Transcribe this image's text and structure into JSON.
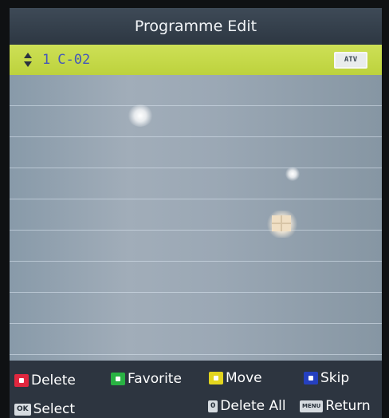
{
  "title": "Programme Edit",
  "selected_channel": {
    "number": "1",
    "name": "C-02",
    "type_badge": "ATV"
  },
  "colors": {
    "header": "#34404b",
    "selected_row": "#c6d94a",
    "list_background": "#96a3b0",
    "footer": "#2d3540",
    "red_key": "#e0273f",
    "green_key": "#29b243",
    "yellow_key": "#e3d51e",
    "blue_key": "#2540bf"
  },
  "footer": {
    "delete_label": "Delete",
    "favorite_label": "Favorite",
    "move_label": "Move",
    "skip_label": "Skip",
    "ok_key": "OK",
    "select_label": "Select",
    "zero_key": "0",
    "delete_all_label": "Delete All",
    "menu_key": "MENU",
    "return_label": "Return"
  }
}
